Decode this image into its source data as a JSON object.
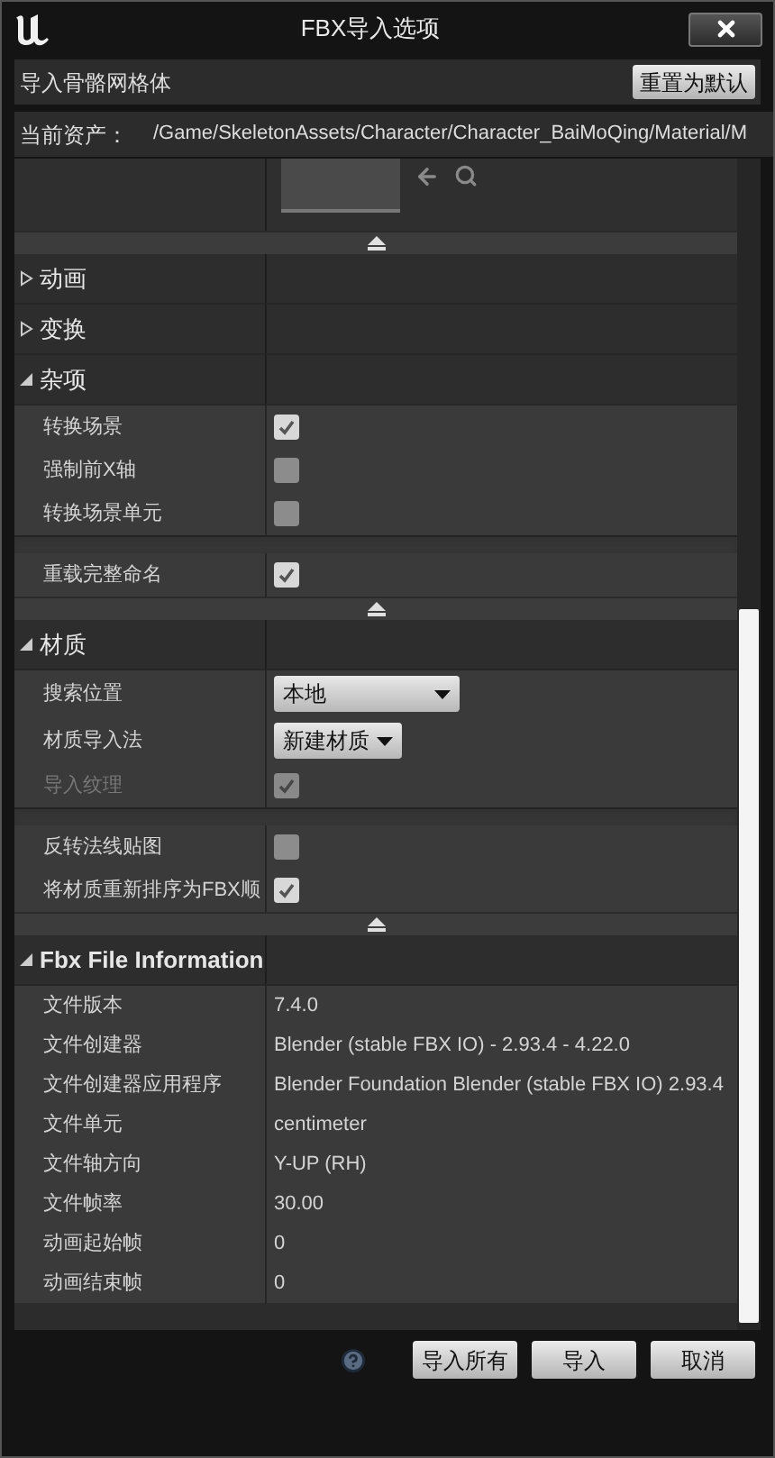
{
  "window": {
    "title": "FBX导入选项"
  },
  "header": {
    "title": "导入骨骼网格体",
    "reset_button": "重置为默认"
  },
  "current_asset": {
    "label": "当前资产：",
    "path": "/Game/SkeletonAssets/Character/Character_BaiMoQing/Material/M"
  },
  "items": [
    {
      "kind": "asset_preview"
    },
    {
      "kind": "collapse_bar"
    },
    {
      "kind": "category",
      "label": "动画",
      "expanded": false
    },
    {
      "kind": "category",
      "label": "变换",
      "expanded": false
    },
    {
      "kind": "category",
      "label": "杂项",
      "expanded": true
    },
    {
      "kind": "checkbox",
      "label": "转换场景",
      "checked": true,
      "disabled": false
    },
    {
      "kind": "checkbox",
      "label": "强制前X轴",
      "checked": false,
      "disabled": false
    },
    {
      "kind": "checkbox",
      "label": "转换场景单元",
      "checked": false,
      "disabled": false
    },
    {
      "kind": "group_break"
    },
    {
      "kind": "checkbox",
      "label": "重载完整命名",
      "checked": true,
      "disabled": false
    },
    {
      "kind": "collapse_bar"
    },
    {
      "kind": "category",
      "label": "材质",
      "expanded": true
    },
    {
      "kind": "dropdown",
      "label": "搜索位置",
      "value": "本地",
      "wide": true
    },
    {
      "kind": "dropdown",
      "label": "材质导入法",
      "value": "新建材质",
      "wide": false
    },
    {
      "kind": "checkbox",
      "label": "导入纹理",
      "checked": true,
      "disabled": true
    },
    {
      "kind": "group_break"
    },
    {
      "kind": "checkbox",
      "label": "反转法线贴图",
      "checked": false,
      "disabled": false
    },
    {
      "kind": "checkbox",
      "label": "将材质重新排序为FBX顺",
      "checked": true,
      "disabled": false
    },
    {
      "kind": "collapse_bar"
    },
    {
      "kind": "category",
      "label": "Fbx File Information",
      "expanded": true
    },
    {
      "kind": "info",
      "label": "文件版本",
      "value": "7.4.0"
    },
    {
      "kind": "info",
      "label": "文件创建器",
      "value": "Blender (stable FBX IO) - 2.93.4 - 4.22.0"
    },
    {
      "kind": "info",
      "label": "文件创建器应用程序",
      "value": "Blender Foundation Blender (stable FBX IO) 2.93.4"
    },
    {
      "kind": "info",
      "label": "文件单元",
      "value": "centimeter"
    },
    {
      "kind": "info",
      "label": "文件轴方向",
      "value": "Y-UP (RH)"
    },
    {
      "kind": "info",
      "label": "文件帧率",
      "value": "30.00"
    },
    {
      "kind": "info",
      "label": "动画起始帧",
      "value": "0"
    },
    {
      "kind": "info",
      "label": "动画结束帧",
      "value": "0"
    }
  ],
  "buttons": [
    "导入所有",
    "导入",
    "取消"
  ]
}
